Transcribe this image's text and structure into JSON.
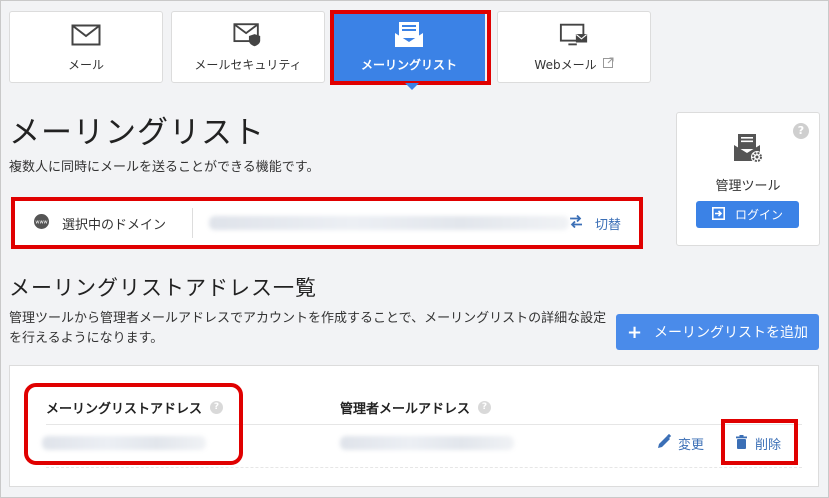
{
  "tabs": [
    {
      "label": "メール",
      "icon": "mail-icon",
      "active": false
    },
    {
      "label": "メールセキュリティ",
      "icon": "mail-security-icon",
      "active": false
    },
    {
      "label": "メーリングリスト",
      "icon": "mailing-list-icon",
      "active": true
    },
    {
      "label": "Webメール",
      "icon": "webmail-icon",
      "external_icon": "external-link-icon",
      "active": false
    }
  ],
  "page": {
    "title": "メーリングリスト",
    "description": "複数人に同時にメールを送ることができる機能です。"
  },
  "domain": {
    "label": "選択中のドメイン",
    "icon": "globe-icon",
    "switch_label": "切替",
    "switch_icon": "swap-arrows-icon"
  },
  "admin_tool": {
    "label": "管理ツール",
    "help": "?",
    "login_label": "ログイン",
    "icon": "admin-tool-icon"
  },
  "list_section": {
    "title": "メーリングリストアドレス一覧",
    "description": "管理ツールから管理者メールアドレスでアカウントを作成することで、メーリングリストの詳細な設定を行えるようになります。",
    "add_button": "メーリングリストを追加",
    "columns": [
      "メーリングリストアドレス",
      "管理者メールアドレス"
    ],
    "help": "?",
    "row_actions": {
      "edit": "変更",
      "delete": "削除"
    }
  },
  "colors": {
    "accent": "#3b82e6",
    "highlight": "#e00000",
    "link": "#3b6fb6"
  }
}
